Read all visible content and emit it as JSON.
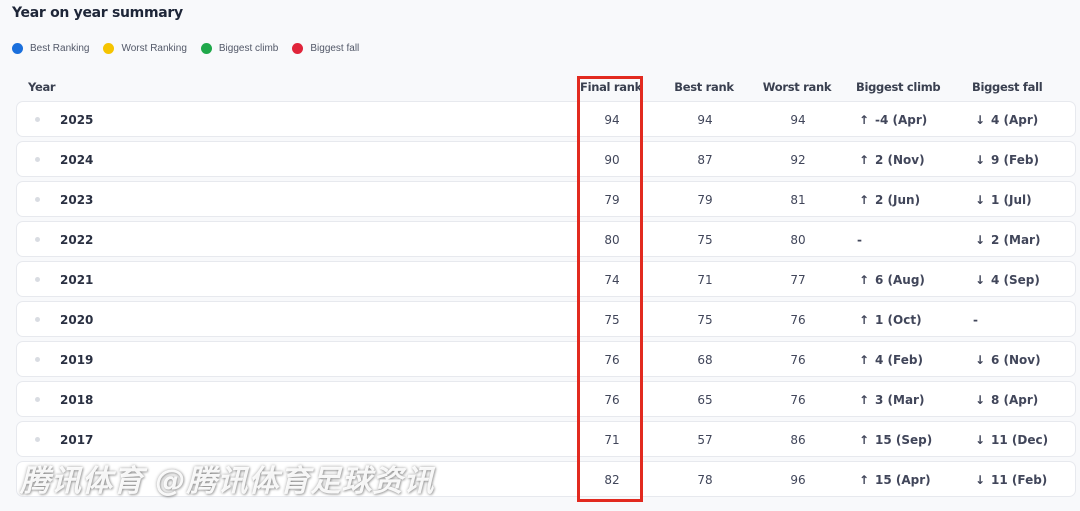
{
  "title": "Year on year summary",
  "legend": [
    {
      "label": "Best Ranking",
      "color": "#1a6fdc"
    },
    {
      "label": "Worst Ranking",
      "color": "#f5c400"
    },
    {
      "label": "Biggest climb",
      "color": "#1fa84a"
    },
    {
      "label": "Biggest fall",
      "color": "#e0243a"
    }
  ],
  "columns": {
    "year": "Year",
    "final_rank": "Final rank",
    "best_rank": "Best rank",
    "worst_rank": "Worst rank",
    "biggest_climb": "Biggest climb",
    "biggest_fall": "Biggest fall"
  },
  "rows": [
    {
      "year": "2025",
      "final": "94",
      "best": "94",
      "worst": "94",
      "climb": "-4 (Apr)",
      "fall": "4 (Apr)"
    },
    {
      "year": "2024",
      "final": "90",
      "best": "87",
      "worst": "92",
      "climb": "2 (Nov)",
      "fall": "9 (Feb)"
    },
    {
      "year": "2023",
      "final": "79",
      "best": "79",
      "worst": "81",
      "climb": "2 (Jun)",
      "fall": "1 (Jul)"
    },
    {
      "year": "2022",
      "final": "80",
      "best": "75",
      "worst": "80",
      "climb": "-",
      "fall": "2 (Mar)"
    },
    {
      "year": "2021",
      "final": "74",
      "best": "71",
      "worst": "77",
      "climb": "6 (Aug)",
      "fall": "4 (Sep)"
    },
    {
      "year": "2020",
      "final": "75",
      "best": "75",
      "worst": "76",
      "climb": "1 (Oct)",
      "fall": "-"
    },
    {
      "year": "2019",
      "final": "76",
      "best": "68",
      "worst": "76",
      "climb": "4 (Feb)",
      "fall": "6 (Nov)"
    },
    {
      "year": "2018",
      "final": "76",
      "best": "65",
      "worst": "76",
      "climb": "3 (Mar)",
      "fall": "8 (Apr)"
    },
    {
      "year": "2017",
      "final": "71",
      "best": "57",
      "worst": "86",
      "climb": "15 (Sep)",
      "fall": "11 (Dec)"
    },
    {
      "year": "",
      "final": "82",
      "best": "78",
      "worst": "96",
      "climb": "15 (Apr)",
      "fall": "11 (Feb)"
    }
  ],
  "icons": {
    "climb": "arrow-up-icon",
    "fall": "arrow-down-icon",
    "highlight_color": "#e22a1f"
  },
  "watermark": "腾讯体育 @腾讯体育足球资讯"
}
